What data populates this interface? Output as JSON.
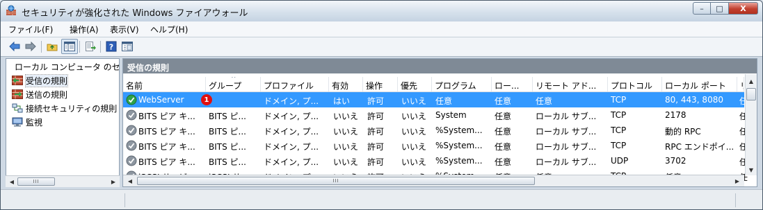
{
  "window": {
    "title": "セキュリティが強化された Windows ファイアウォール",
    "min_glyph": "–",
    "max_glyph": "□",
    "close_glyph": "X"
  },
  "menu": [
    "ファイル(F)",
    "操作(A)",
    "表示(V)",
    "ヘルプ(H)"
  ],
  "nav": {
    "items": [
      {
        "label": "ローカル コンピュータ のセ",
        "icon": "firewall-icon"
      },
      {
        "label": "受信の規則",
        "icon": "inbound-rules-icon"
      },
      {
        "label": "送信の規則",
        "icon": "outbound-rules-icon"
      },
      {
        "label": "接続セキュリティの規則",
        "icon": "connection-security-icon"
      },
      {
        "label": "監視",
        "icon": "monitoring-icon"
      }
    ],
    "selected_index": 1
  },
  "section_header": "受信の規則",
  "columns": [
    "名前",
    "グループ",
    "プロファイル",
    "有効",
    "操作",
    "優先",
    "プログラム",
    "ロー...",
    "リモート アド...",
    "プロトコル",
    "ローカル ポート",
    "リ"
  ],
  "sorted_column": "グループ",
  "sort_glyph": "^",
  "rows": [
    {
      "name": "WebServer",
      "group": "",
      "profile": "ドメイン, プ...",
      "enabled": "はい",
      "action": "許可",
      "override": "いいえ",
      "program": "任意",
      "local": "任意",
      "remote": "任意",
      "protocol": "TCP",
      "local_port": "80, 443, 8080",
      "extra": "任",
      "selected": true
    },
    {
      "name": "BITS ピア キ...",
      "group": "BITS ピ...",
      "profile": "ドメイン, プ...",
      "enabled": "いいえ",
      "action": "許可",
      "override": "いいえ",
      "program": "System",
      "local": "任意",
      "remote": "ローカル サブ...",
      "protocol": "TCP",
      "local_port": "2178",
      "extra": "任",
      "selected": false
    },
    {
      "name": "BITS ピア キ...",
      "group": "BITS ピ...",
      "profile": "ドメイン, プ...",
      "enabled": "いいえ",
      "action": "許可",
      "override": "いいえ",
      "program": "%System...",
      "local": "任意",
      "remote": "ローカル サブ...",
      "protocol": "TCP",
      "local_port": "動的 RPC",
      "extra": "任",
      "selected": false
    },
    {
      "name": "BITS ピア キ...",
      "group": "BITS ピ...",
      "profile": "ドメイン, プ...",
      "enabled": "いいえ",
      "action": "許可",
      "override": "いいえ",
      "program": "%System...",
      "local": "任意",
      "remote": "ローカル サブ...",
      "protocol": "TCP",
      "local_port": "RPC エンドポイ...",
      "extra": "任",
      "selected": false
    },
    {
      "name": "BITS ピア キ...",
      "group": "BITS ピ...",
      "profile": "ドメイン, プ...",
      "enabled": "いいえ",
      "action": "許可",
      "override": "いいえ",
      "program": "%System...",
      "local": "任意",
      "remote": "ローカル サブ...",
      "protocol": "UDP",
      "local_port": "3702",
      "extra": "任",
      "selected": false
    },
    {
      "name": "iSCSI サービ...",
      "group": "iSCSI サ...",
      "profile": "ドメイン, プ...",
      "enabled": "いいえ",
      "action": "許可",
      "override": "いいえ",
      "program": "%System...",
      "local": "任意",
      "remote": "任意",
      "protocol": "TCP",
      "local_port": "任意",
      "extra": "任",
      "selected": false
    }
  ],
  "callout_number": "1",
  "scroll_grip": "III",
  "colors": {
    "selection": "#3399ff",
    "section_header": "#7f8a96",
    "callout": "#e01010"
  }
}
